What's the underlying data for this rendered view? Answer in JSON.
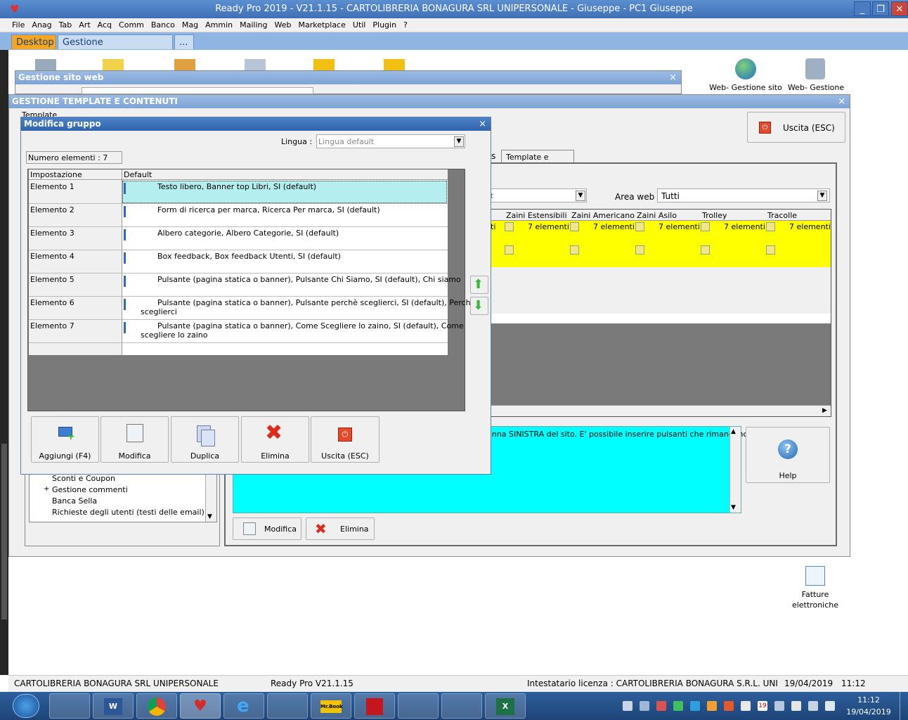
{
  "window": {
    "title": "Ready Pro 2019 - V21.1.15 - CARTOLIBRERIA BONAGURA SRL UNIPERSONALE - Giuseppe - PC1 Giuseppe",
    "minimize": "_",
    "maximize": "❐",
    "close": "✕"
  },
  "menu": [
    "File",
    "Anag",
    "Tab",
    "Art",
    "Acq",
    "Comm",
    "Banco",
    "Mag",
    "Ammin",
    "Mailing",
    "Web",
    "Marketplace",
    "Util",
    "Plugin",
    "?"
  ],
  "tabs": {
    "desktop": "Desktop",
    "messaggistica": "Gestione messaggistica",
    "more": "..."
  },
  "desktop_icons": {
    "web_site": "Web- Gestione sito",
    "web_gestione": "Web- Gestione",
    "fatture": "Fatture elettroniche"
  },
  "win_sito": {
    "title": "Gestione sito web",
    "close": "×"
  },
  "win_template": {
    "title": "GESTIONE TEMPLATE E CONTENUTI",
    "close": "×",
    "template_label": "Template",
    "exit_label": "Uscita (ESC)",
    "tab_partial": "s",
    "tab_plugins": "Template e plugins",
    "filter_value": "lt",
    "area_label": "Area web :",
    "area_value": "Tutti",
    "grid_headers": [
      "Zaini  Estensibili",
      "Zaini  Americano",
      "Zaini  Asilo",
      "Trolley",
      "Tracolle"
    ],
    "grid_row1_prefix": "ti",
    "grid_row1_value": "7 elementi",
    "description": "lonna SINISTRA del sito. E' possibile inserire pulsanti che rimandano a",
    "help_label": "Help",
    "modifica_label": "Modifica",
    "elimina_label": "Elimina",
    "tree_items": [
      "Sconti e Coupon",
      "Gestione commenti",
      "Banca Sella",
      "Richieste degli utenti (testi delle email)"
    ],
    "tree_expand": "+"
  },
  "dialog": {
    "title": "Modifica gruppo",
    "close": "×",
    "lingua_label": "Lingua :",
    "lingua_value": "Lingua default",
    "count_label": "Numero elementi : 7",
    "col_impostazione": "Impostazione",
    "col_default": "Default",
    "rows": [
      {
        "name": "Elemento 1",
        "value": "Testo libero, Banner top Libri, SI (default)",
        "cont": ""
      },
      {
        "name": "Elemento 2",
        "value": "Form di ricerca per marca, Ricerca Per marca, SI (default)",
        "cont": ""
      },
      {
        "name": "Elemento 3",
        "value": "Albero categorie, Albero Categorie, SI (default)",
        "cont": ""
      },
      {
        "name": "Elemento 4",
        "value": "Box feedback, Box feedback Utenti, SI (default)",
        "cont": ""
      },
      {
        "name": "Elemento 5",
        "value": "Pulsante (pagina statica o banner), Pulsante Chi Siamo, SI (default), Chi siamo",
        "cont": ""
      },
      {
        "name": "Elemento 6",
        "value": "Pulsante (pagina statica o banner), Pulsante perchè sceglierci, SI (default), Perchè",
        "cont": "sceglierci"
      },
      {
        "name": "Elemento 7",
        "value": "Pulsante (pagina statica o banner), Come Scegliere lo zaino, SI (default), Come",
        "cont": "scegliere lo zaino"
      }
    ],
    "buttons": {
      "add": "Aggiungi (F4)",
      "edit": "Modifica",
      "dup": "Duplica",
      "del": "Elimina",
      "exit": "Uscita (ESC)"
    }
  },
  "status": {
    "company": "CARTOLIBRERIA BONAGURA SRL UNIPERSONALE",
    "version": "Ready Pro V21.1.15",
    "license": "Intestatario licenza : CARTOLIBRERIA BONAGURA S.R.L. UNI",
    "date": "19/04/2019",
    "time": "11:12"
  },
  "taskbar": {
    "time": "11:12",
    "date": "19/04/2019",
    "calendar_day": "19",
    "mrbook": "Mr.Book"
  }
}
